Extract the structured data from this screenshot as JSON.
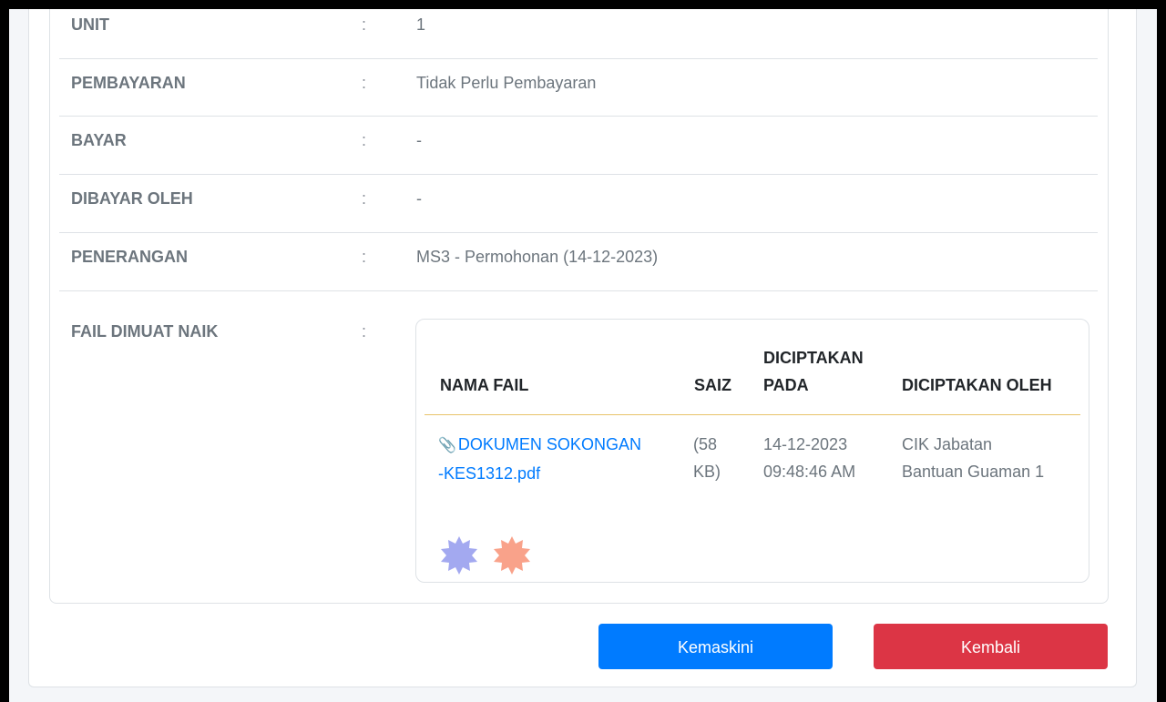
{
  "details": [
    {
      "label": "UNIT",
      "value": "1"
    },
    {
      "label": "PEMBAYARAN",
      "value": "Tidak Perlu Pembayaran"
    },
    {
      "label": "BAYAR",
      "value": "-"
    },
    {
      "label": "DIBAYAR OLEH",
      "value": "-"
    },
    {
      "label": "PENERANGAN",
      "value": "MS3 - Permohonan (14-12-2023)"
    }
  ],
  "separator": ":",
  "files_section": {
    "label": "FAIL DIMUAT NAIK",
    "headers": {
      "name": "NAMA FAIL",
      "size": "SAIZ",
      "created_at_line1": "DICIPTAKAN",
      "created_at_line2": "PADA",
      "created_by": "DICIPTAKAN OLEH"
    },
    "rows": [
      {
        "name_line1": "DOKUMEN SOKONGAN",
        "name_line2": "-KES1312.pdf",
        "size_line1": "(58",
        "size_line2": "KB)",
        "date": "14-12-2023",
        "time": "09:48:46 AM",
        "creator_line1": "CIK Jabatan",
        "creator_line2": "Bantuan Guaman 1"
      }
    ],
    "badge_colors": [
      "#a3a9f0",
      "#f9a28a"
    ]
  },
  "buttons": {
    "update": "Kemaskini",
    "back": "Kembali"
  }
}
